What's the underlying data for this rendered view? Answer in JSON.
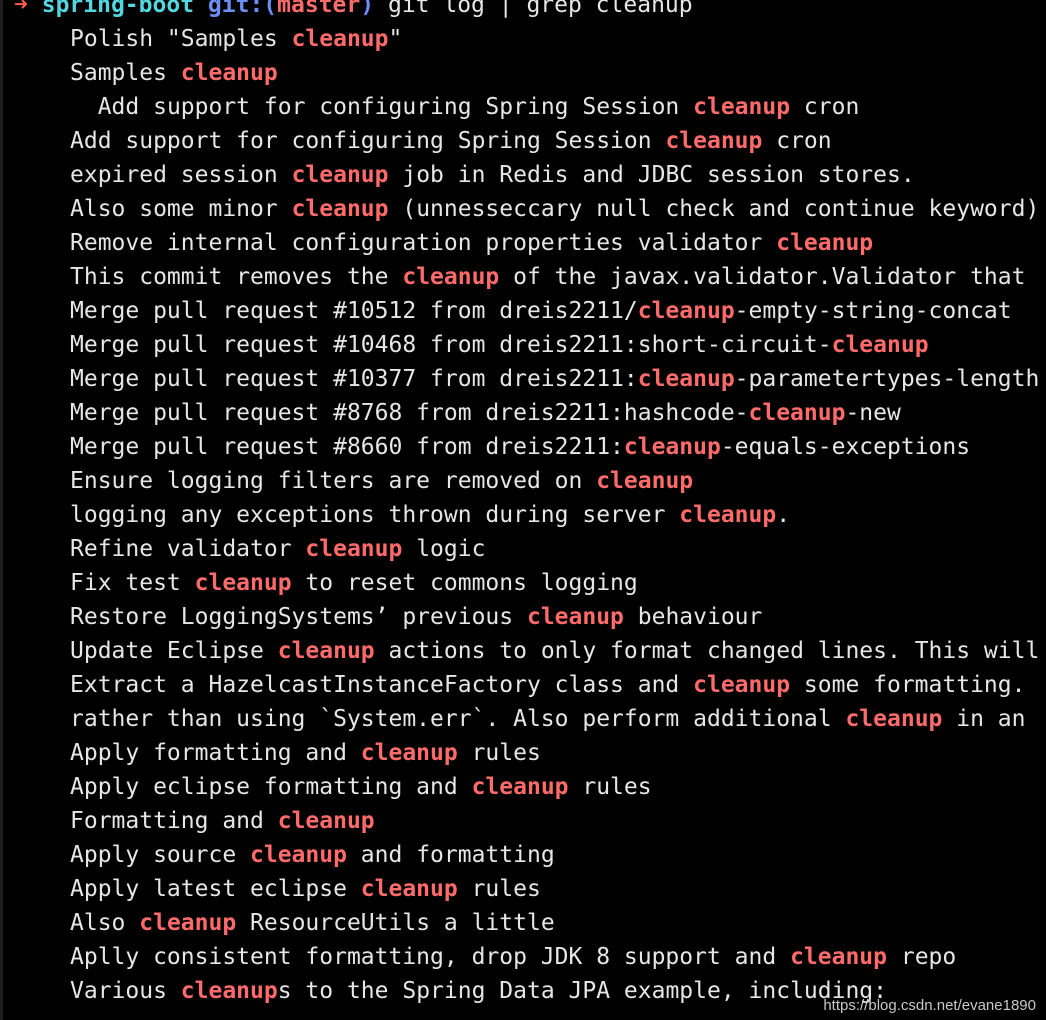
{
  "prompt": {
    "arrow": "➜",
    "directory": "spring-boot",
    "git_label": "git:(",
    "branch": "master",
    "git_close": ")",
    "command": "git log | grep cleanup"
  },
  "output_lines": [
    {
      "indent": "",
      "before": "Polish \"Samples ",
      "match": "cleanup",
      "after": "\""
    },
    {
      "indent": "",
      "before": "Samples ",
      "match": "cleanup",
      "after": ""
    },
    {
      "indent": "  ",
      "before": "Add support for configuring Spring Session ",
      "match": "cleanup",
      "after": " cron"
    },
    {
      "indent": "",
      "before": "Add support for configuring Spring Session ",
      "match": "cleanup",
      "after": " cron"
    },
    {
      "indent": "",
      "before": "expired session ",
      "match": "cleanup",
      "after": " job in Redis and JDBC session stores."
    },
    {
      "indent": "",
      "before": "Also some minor ",
      "match": "cleanup",
      "after": " (unnesseccary null check and continue keyword)"
    },
    {
      "indent": "",
      "before": "Remove internal configuration properties validator ",
      "match": "cleanup",
      "after": ""
    },
    {
      "indent": "",
      "before": "This commit removes the ",
      "match": "cleanup",
      "after": " of the javax.validator.Validator that"
    },
    {
      "indent": "",
      "before": "Merge pull request #10512 from dreis2211/",
      "match": "cleanup",
      "after": "-empty-string-concat"
    },
    {
      "indent": "",
      "before": "Merge pull request #10468 from dreis2211:short-circuit-",
      "match": "cleanup",
      "after": ""
    },
    {
      "indent": "",
      "before": "Merge pull request #10377 from dreis2211:",
      "match": "cleanup",
      "after": "-parametertypes-length"
    },
    {
      "indent": "",
      "before": "Merge pull request #8768 from dreis2211:hashcode-",
      "match": "cleanup",
      "after": "-new"
    },
    {
      "indent": "",
      "before": "Merge pull request #8660 from dreis2211:",
      "match": "cleanup",
      "after": "-equals-exceptions"
    },
    {
      "indent": "",
      "before": "Ensure logging filters are removed on ",
      "match": "cleanup",
      "after": ""
    },
    {
      "indent": "",
      "before": "logging any exceptions thrown during server ",
      "match": "cleanup",
      "after": "."
    },
    {
      "indent": "",
      "before": "Refine validator ",
      "match": "cleanup",
      "after": " logic"
    },
    {
      "indent": "",
      "before": "Fix test ",
      "match": "cleanup",
      "after": " to reset commons logging"
    },
    {
      "indent": "",
      "before": "Restore LoggingSystems’ previous ",
      "match": "cleanup",
      "after": " behaviour"
    },
    {
      "indent": "",
      "before": "Update Eclipse ",
      "match": "cleanup",
      "after": " actions to only format changed lines. This will"
    },
    {
      "indent": "",
      "before": "Extract a HazelcastInstanceFactory class and ",
      "match": "cleanup",
      "after": " some formatting."
    },
    {
      "indent": "",
      "before": "rather than using `System.err`. Also perform additional ",
      "match": "cleanup",
      "after": " in an"
    },
    {
      "indent": "",
      "before": "Apply formatting and ",
      "match": "cleanup",
      "after": " rules"
    },
    {
      "indent": "",
      "before": "Apply eclipse formatting and ",
      "match": "cleanup",
      "after": " rules"
    },
    {
      "indent": "",
      "before": "Formatting and ",
      "match": "cleanup",
      "after": ""
    },
    {
      "indent": "",
      "before": "Apply source ",
      "match": "cleanup",
      "after": " and formatting"
    },
    {
      "indent": "",
      "before": "Apply latest eclipse ",
      "match": "cleanup",
      "after": " rules"
    },
    {
      "indent": "",
      "before": "Also ",
      "match": "cleanup",
      "after": " ResourceUtils a little"
    },
    {
      "indent": "",
      "before": "Aplly consistent formatting, drop JDK 8 support and ",
      "match": "cleanup",
      "after": " repo"
    },
    {
      "indent": "",
      "before": "Various ",
      "match": "cleanup",
      "after": "s to the Spring Data JPA example, including:"
    }
  ],
  "watermark": "https://blog.csdn.net/evane1890",
  "colors": {
    "background": "#000000",
    "text": "#e6e6e6",
    "arrow": "#ff5b4d",
    "directory": "#52d6df",
    "git_label": "#6b8ef7",
    "match": "#ff6a6a"
  }
}
